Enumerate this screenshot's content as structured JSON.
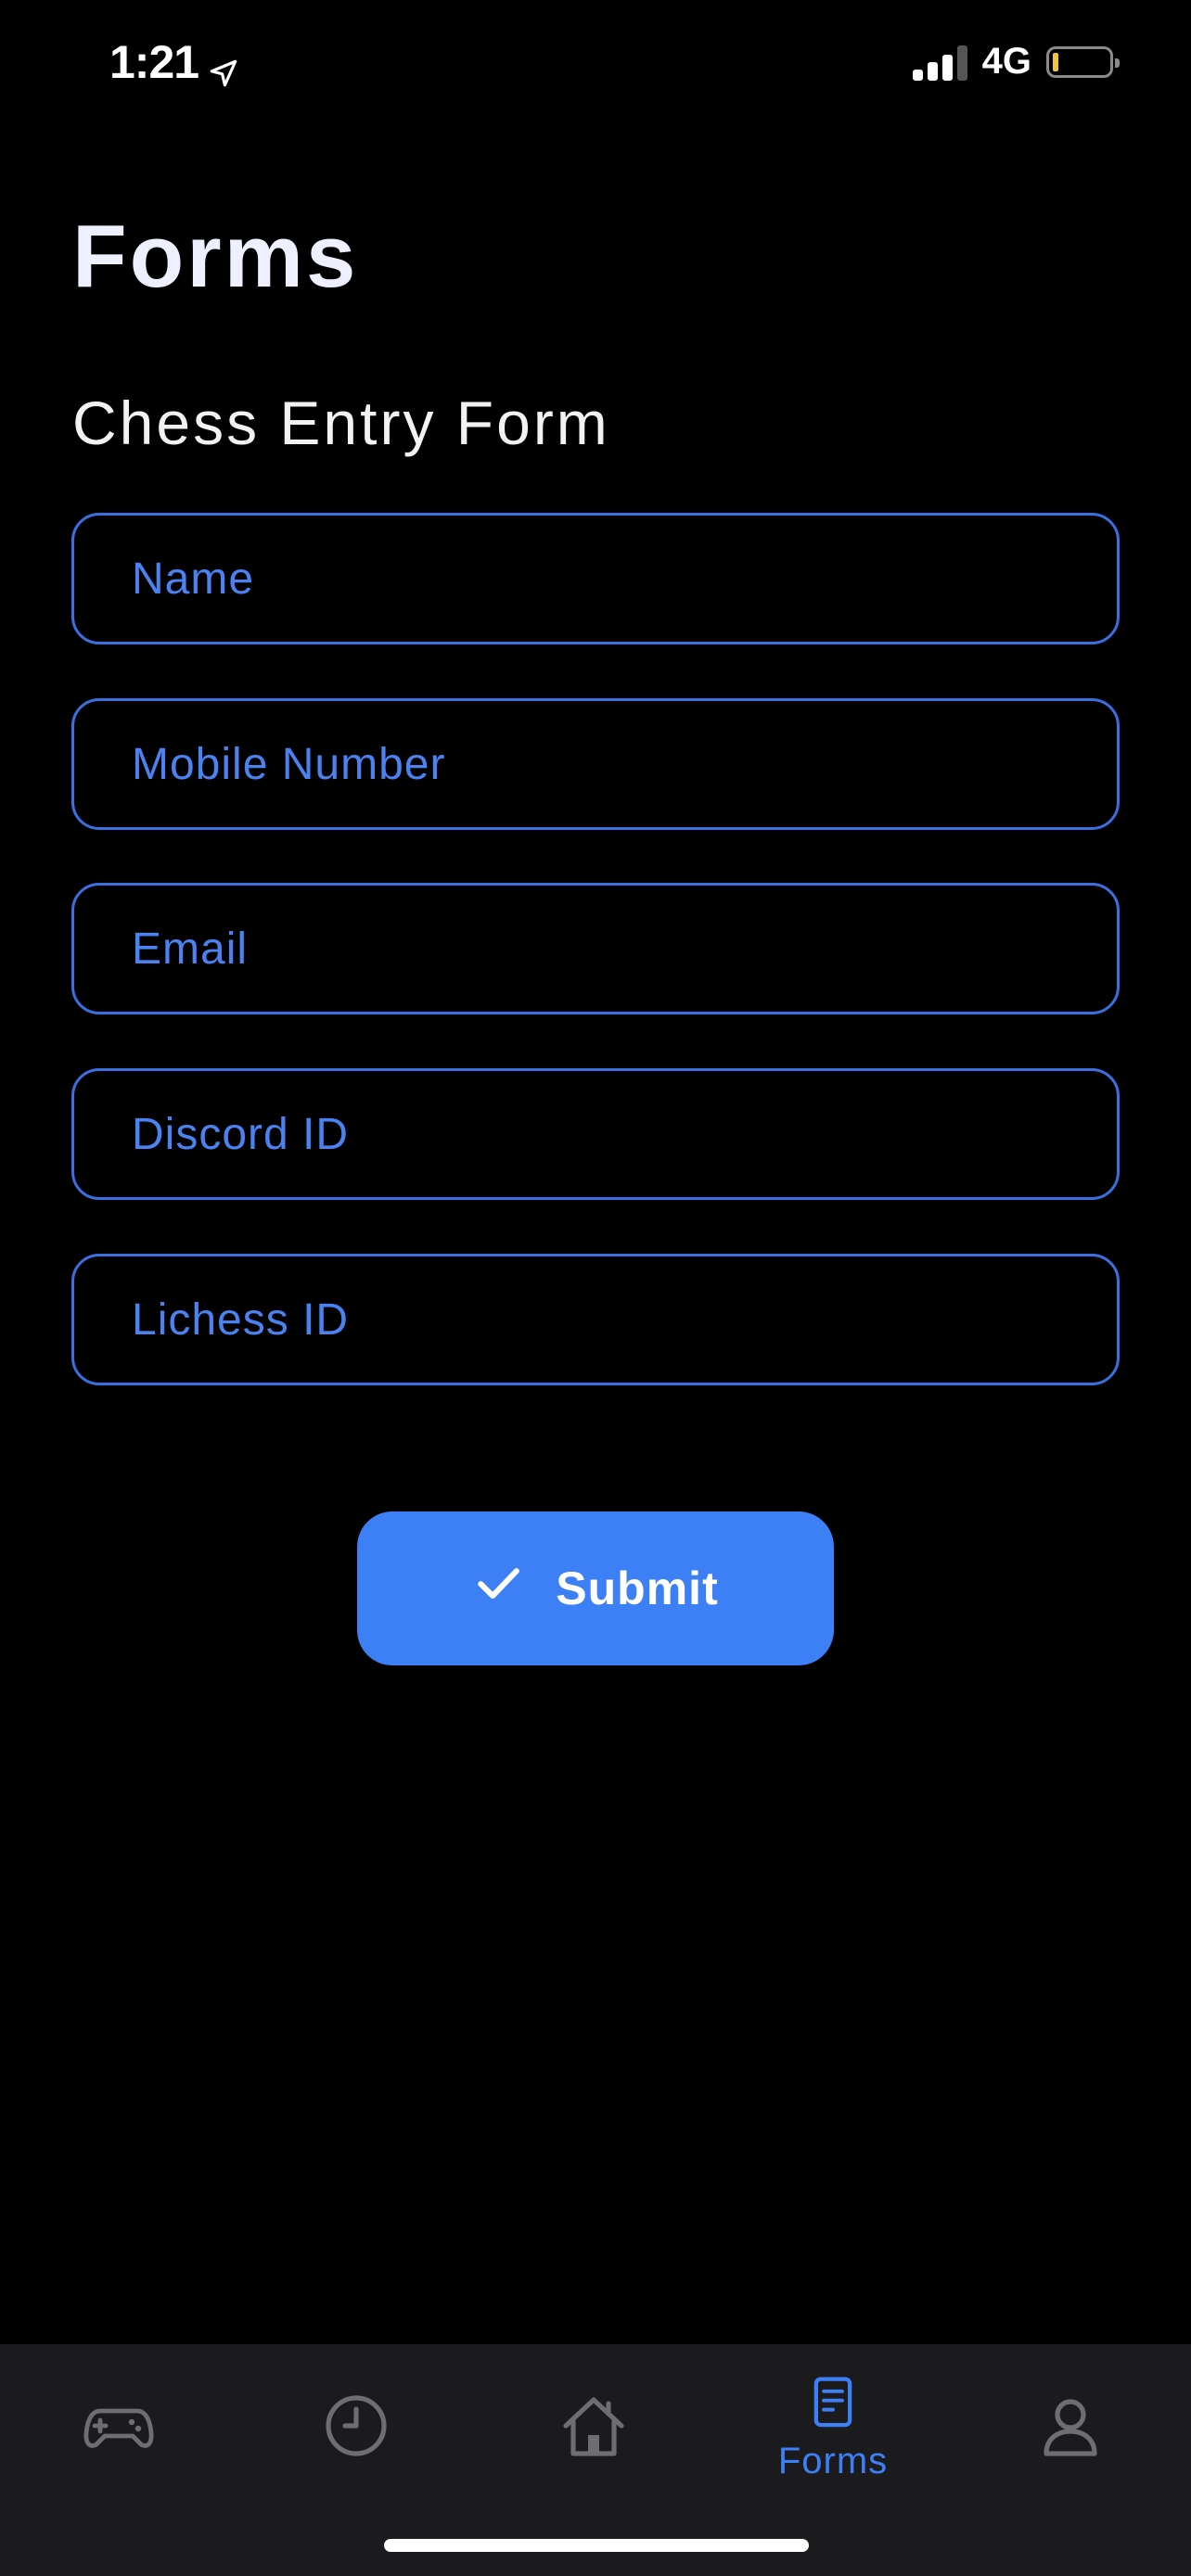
{
  "status_bar": {
    "time": "1:21",
    "network": "4G",
    "location_icon": "location-arrow-icon",
    "battery_icon": "battery-low-icon"
  },
  "header": {
    "title": "Forms"
  },
  "form": {
    "title": "Chess Entry Form",
    "fields": [
      {
        "placeholder": "Name",
        "value": ""
      },
      {
        "placeholder": "Mobile Number",
        "value": ""
      },
      {
        "placeholder": "Email",
        "value": ""
      },
      {
        "placeholder": "Discord ID",
        "value": ""
      },
      {
        "placeholder": "Lichess ID",
        "value": ""
      }
    ],
    "submit_label": "Submit",
    "submit_icon": "checkmark-icon"
  },
  "tab_bar": {
    "tabs": [
      {
        "icon": "gamepad-icon",
        "label": "",
        "active": false
      },
      {
        "icon": "clock-icon",
        "label": "",
        "active": false
      },
      {
        "icon": "home-icon",
        "label": "",
        "active": false
      },
      {
        "icon": "document-icon",
        "label": "Forms",
        "active": true
      },
      {
        "icon": "profile-icon",
        "label": "",
        "active": false
      }
    ]
  },
  "colors": {
    "background": "#000000",
    "accent": "#3d7ff5",
    "field_border": "#3a6fe0",
    "tab_bar_bg": "#1b1b1d",
    "inactive_icon": "#6e6e72"
  }
}
